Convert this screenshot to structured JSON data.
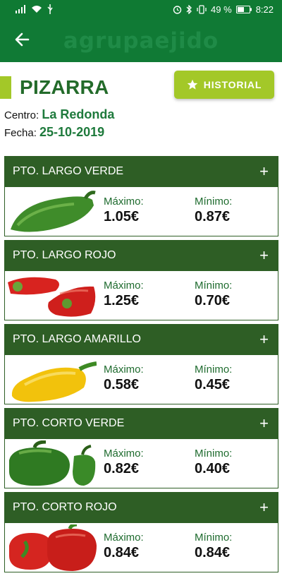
{
  "status_bar": {
    "battery": "49 %",
    "time": "8:22"
  },
  "app_bar": {
    "logo_text": "agrupaejido"
  },
  "page": {
    "title": "PIZARRA",
    "history_button": "HISTORIAL",
    "center_label": "Centro:",
    "center_value": "La Redonda",
    "date_label": "Fecha:",
    "date_value": "25-10-2019"
  },
  "labels": {
    "max": "Máximo:",
    "min": "Mínimo:"
  },
  "products": [
    {
      "name": "PTO. LARGO VERDE",
      "max": "1.05€",
      "min": "0.87€",
      "image": "green-long-pepper"
    },
    {
      "name": "PTO. LARGO ROJO",
      "max": "1.25€",
      "min": "0.70€",
      "image": "red-long-pepper"
    },
    {
      "name": "PTO. LARGO AMARILLO",
      "max": "0.58€",
      "min": "0.45€",
      "image": "yellow-long-pepper"
    },
    {
      "name": "PTO. CORTO VERDE",
      "max": "0.82€",
      "min": "0.40€",
      "image": "green-short-pepper"
    },
    {
      "name": "PTO. CORTO ROJO",
      "max": "0.84€",
      "min": "0.84€",
      "image": "red-short-pepper"
    }
  ],
  "colors": {
    "status_bar": "#0f7a33",
    "app_bar": "#107a35",
    "card_header": "#2e5e25",
    "accent": "#a3c828",
    "title": "#236b2a"
  }
}
